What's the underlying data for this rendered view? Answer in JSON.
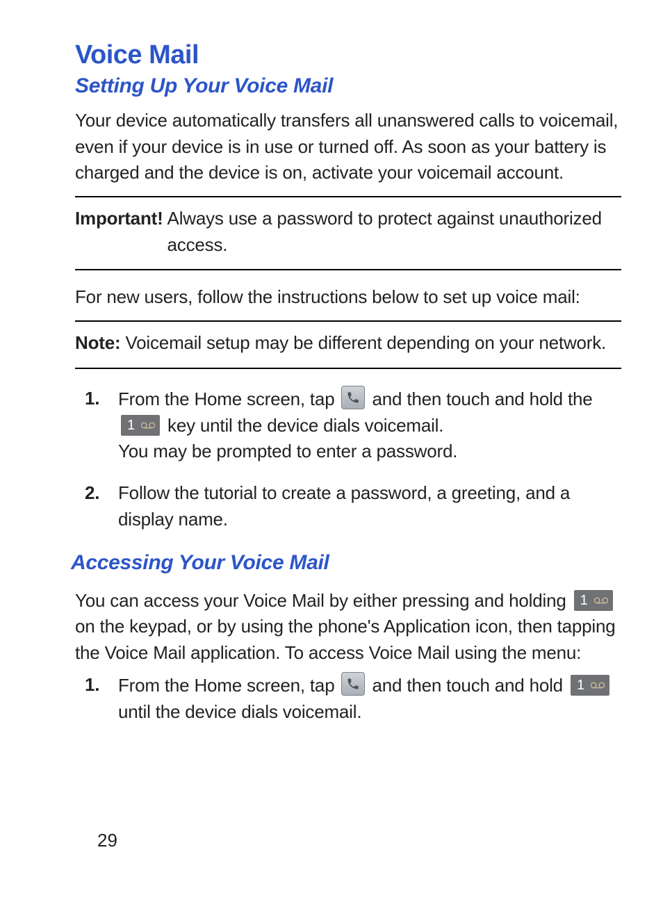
{
  "section": {
    "title": "Voice Mail",
    "setup": {
      "heading": "Setting Up Your Voice Mail",
      "intro": "Your device automatically transfers all unanswered calls to voicemail, even if your device is in use or turned off. As soon as your battery is charged and the device is on, activate your voicemail account.",
      "important_label": "Important!",
      "important_text": "Always use a password to protect against unauthorized access.",
      "new_users": "For new users, follow the instructions below to set up voice mail:",
      "note_label": "Note:",
      "note_text": "Voicemail setup may be different depending on your network.",
      "steps": {
        "s1_a": "From the Home screen, tap ",
        "s1_b": " and then touch and hold the ",
        "s1_c": " key until the device dials voicemail.",
        "s1_d": "You may be prompted to enter a password.",
        "s2": "Follow the tutorial to create a password, a greeting, and a display name."
      }
    },
    "access": {
      "heading": "Accessing Your Voice Mail",
      "intro_a": "You can access your Voice Mail by either pressing and holding ",
      "intro_b": " on the keypad, or by using the phone's Application icon, then tapping the Voice Mail application. To access Voice Mail using the menu:",
      "steps": {
        "s1_a": "From the Home screen, tap ",
        "s1_b": " and then touch and hold ",
        "s1_c": " until the device dials voicemail."
      }
    }
  },
  "icons": {
    "key_digit": "1"
  },
  "page_number": "29"
}
